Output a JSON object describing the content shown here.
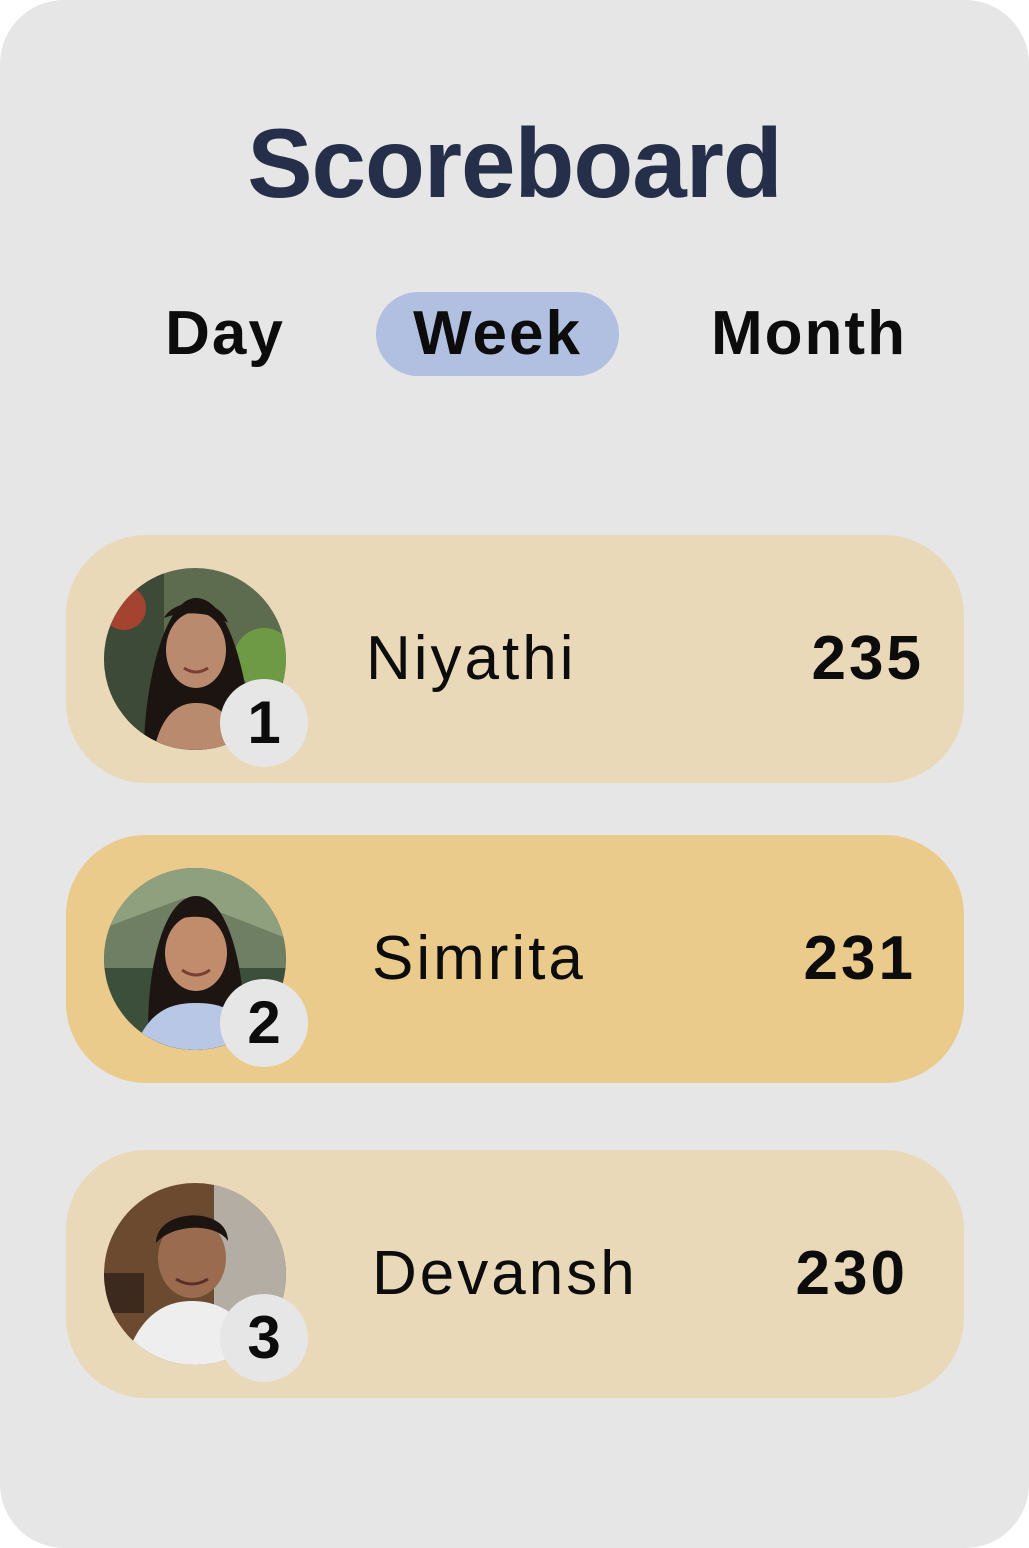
{
  "title": "Scoreboard",
  "tabs": [
    {
      "label": "Day",
      "selected": false
    },
    {
      "label": "Week",
      "selected": true
    },
    {
      "label": "Month",
      "selected": false
    }
  ],
  "colors": {
    "background": "#e6e6e6",
    "title": "#262f4a",
    "tab_selected": "#b1bfe0",
    "row_default": "#e9d9b9",
    "row_highlight": "#eacb8b"
  },
  "entries": [
    {
      "rank": "1",
      "name": "Niyathi",
      "score": "235",
      "avatar": "avatar-photo"
    },
    {
      "rank": "2",
      "name": "Simrita",
      "score": "231",
      "avatar": "avatar-photo"
    },
    {
      "rank": "3",
      "name": "Devansh",
      "score": "230",
      "avatar": "avatar-photo"
    }
  ]
}
